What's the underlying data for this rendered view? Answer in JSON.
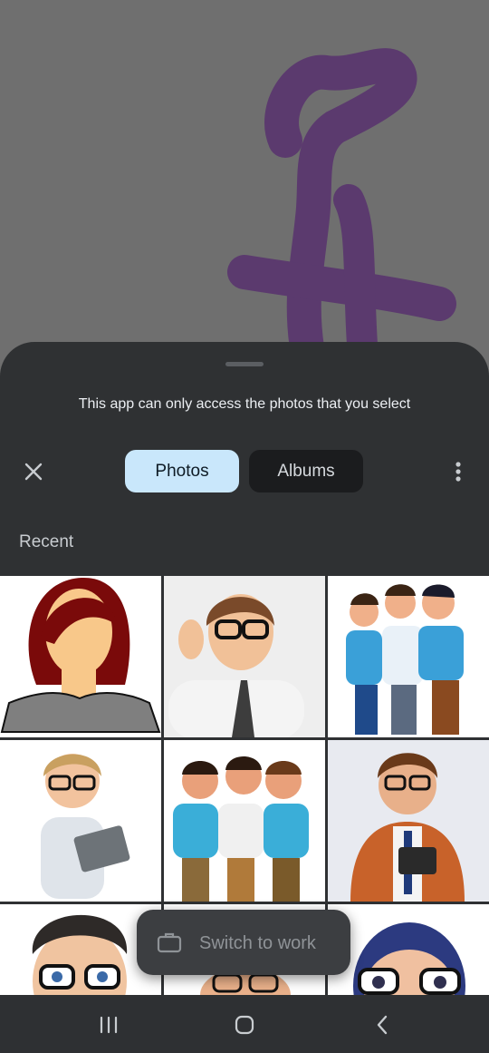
{
  "sheet": {
    "notice": "This app can only access the photos that you select",
    "close_icon": "close-icon",
    "more_icon": "more-vertical-icon"
  },
  "tabs": [
    {
      "label": "Photos",
      "selected": true
    },
    {
      "label": "Albums",
      "selected": false
    }
  ],
  "section_title": "Recent",
  "photos": [
    {
      "row": 0,
      "col": 0,
      "subject": "faceless-cartoon-woman-red-hair"
    },
    {
      "row": 0,
      "col": 1,
      "subject": "cartoon-man-waving-glasses-tie"
    },
    {
      "row": 0,
      "col": 2,
      "subject": "three-cartoon-students-with-phones"
    },
    {
      "row": 1,
      "col": 0,
      "subject": "cartoon-boy-holding-tablet"
    },
    {
      "row": 1,
      "col": 1,
      "subject": "three-cartoon-boys-selfie"
    },
    {
      "row": 1,
      "col": 2,
      "subject": "cartoon-man-orange-jacket-tablet"
    },
    {
      "row": 2,
      "col": 0,
      "subject": "cartoon-man-glasses-close-up"
    },
    {
      "row": 2,
      "col": 1,
      "subject": "cartoon-partial-face"
    },
    {
      "row": 2,
      "col": 2,
      "subject": "cartoon-boy-blue-hair-glasses"
    }
  ],
  "toast": {
    "label": "Switch to work",
    "icon": "briefcase-icon"
  },
  "nav": [
    {
      "icon": "recent-apps-icon"
    },
    {
      "icon": "home-icon"
    },
    {
      "icon": "back-icon"
    }
  ],
  "colors": {
    "sheet": "#2f3133",
    "selected_tab": "#c9e7fb",
    "unselected_tab": "#1b1c1e",
    "scribble": "#5b3a6e"
  }
}
